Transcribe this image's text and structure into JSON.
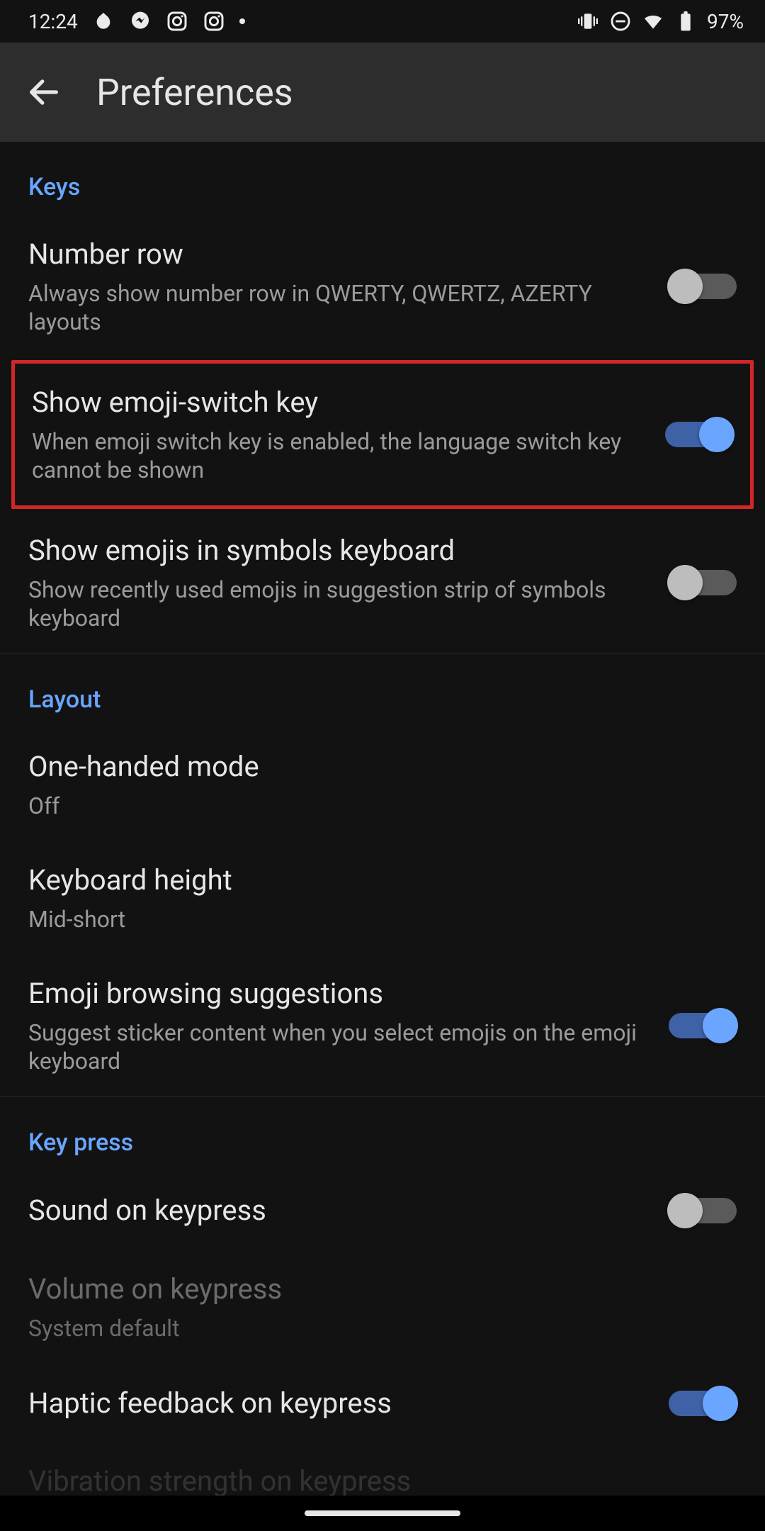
{
  "status_bar": {
    "time": "12:24",
    "battery_pct": "97%"
  },
  "app_bar": {
    "title": "Preferences"
  },
  "sections": {
    "keys": {
      "header": "Keys",
      "number_row": {
        "title": "Number row",
        "sub": "Always show number row in QWERTY, QWERTZ, AZERTY layouts",
        "on": false
      },
      "emoji_switch": {
        "title": "Show emoji-switch key",
        "sub": "When emoji switch key is enabled, the language switch key cannot be shown",
        "on": true
      },
      "emojis_symbols": {
        "title": "Show emojis in symbols keyboard",
        "sub": "Show recently used emojis in suggestion strip of symbols keyboard",
        "on": false
      }
    },
    "layout": {
      "header": "Layout",
      "one_handed": {
        "title": "One-handed mode",
        "sub": "Off"
      },
      "keyboard_height": {
        "title": "Keyboard height",
        "sub": "Mid-short"
      },
      "emoji_browsing": {
        "title": "Emoji browsing suggestions",
        "sub": "Suggest sticker content when you select emojis on the emoji keyboard",
        "on": true
      }
    },
    "key_press": {
      "header": "Key press",
      "sound": {
        "title": "Sound on keypress",
        "on": false
      },
      "volume": {
        "title": "Volume on keypress",
        "sub": "System default",
        "disabled": true
      },
      "haptic": {
        "title": "Haptic feedback on keypress",
        "on": true
      },
      "vibration_strength": {
        "title": "Vibration strength on keypress"
      }
    }
  }
}
